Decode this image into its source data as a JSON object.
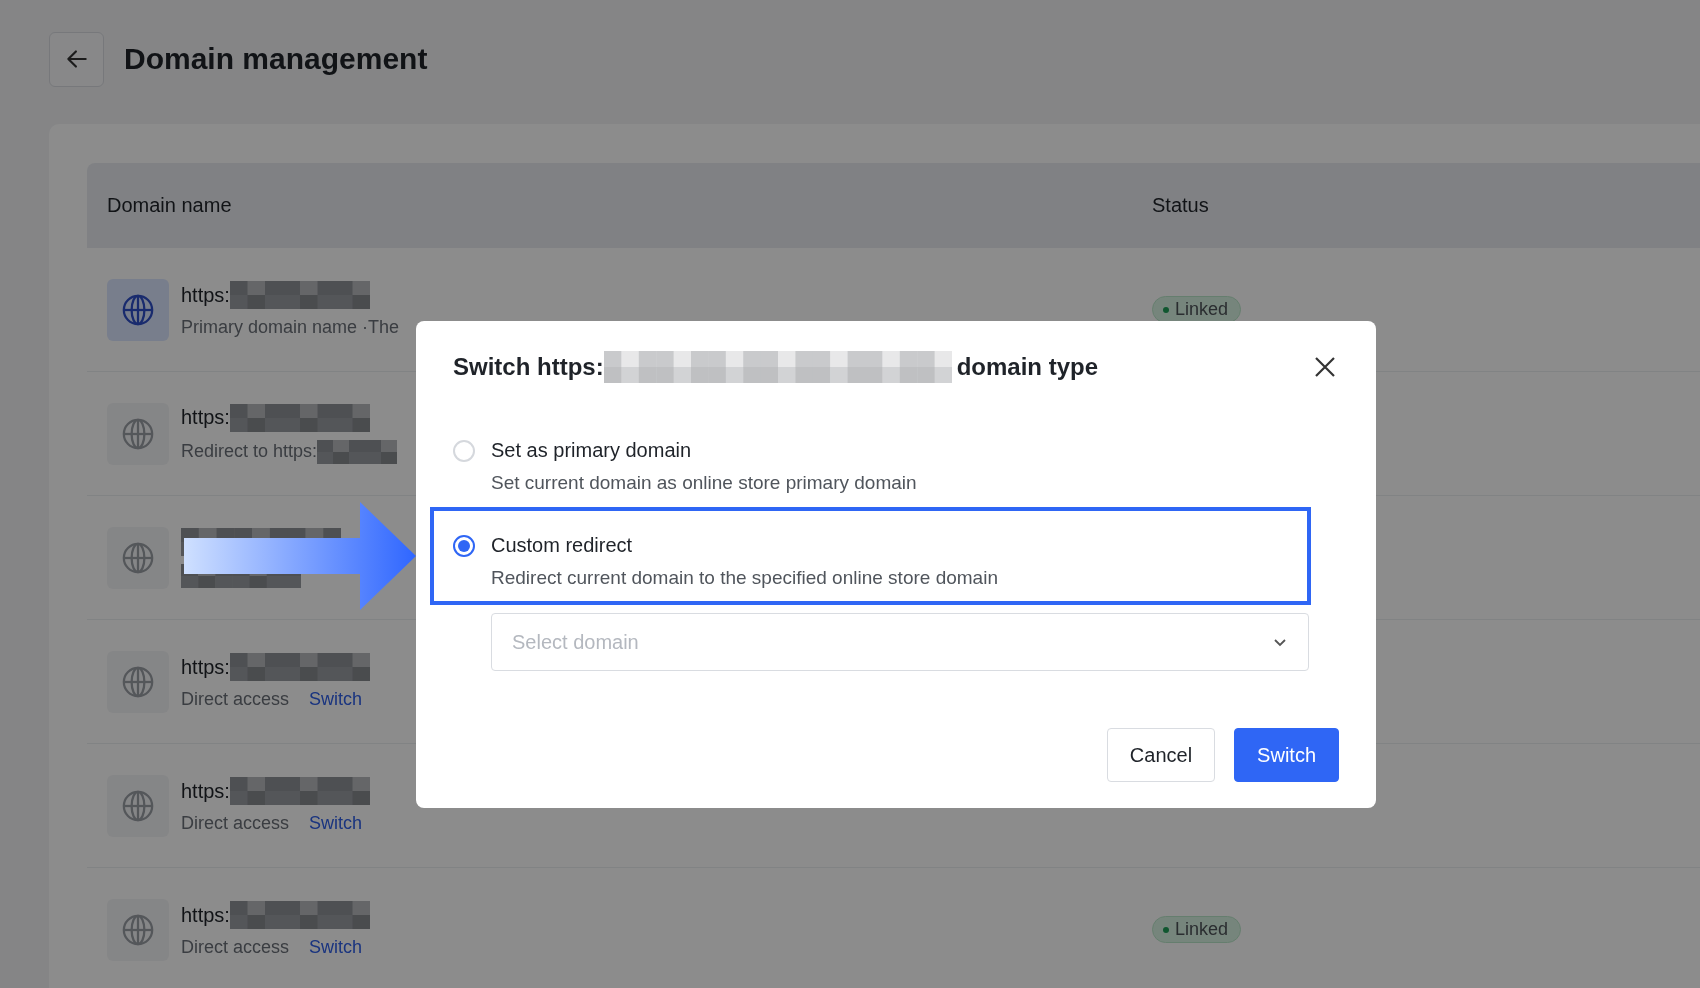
{
  "header": {
    "title": "Domain management"
  },
  "table": {
    "columns": [
      "Domain name",
      "Status"
    ],
    "rows": [
      {
        "primary": true,
        "title": "https:",
        "subtitle": "Primary domain name ·The",
        "subtitle_redacted": false,
        "status": "Linked"
      },
      {
        "primary": false,
        "title": "https:",
        "subtitle": "Redirect to https:",
        "subtitle_redacted": true
      },
      {
        "primary": false
      },
      {
        "primary": false,
        "title": "https:",
        "subtitle": "Direct access",
        "subtitle_redacted": false,
        "link": "Switch"
      },
      {
        "primary": false,
        "title": "https:",
        "subtitle": "Direct access",
        "subtitle_redacted": false,
        "link": "Switch"
      },
      {
        "primary": false,
        "title": "https:",
        "subtitle": "Direct access",
        "subtitle_redacted": false,
        "link": "Switch",
        "status": "Linked"
      }
    ]
  },
  "dialog": {
    "title_prefix": "Switch https:",
    "title_suffix": "domain type",
    "options": [
      {
        "label": "Set as primary domain",
        "description": "Set current domain as online store primary domain",
        "selected": false
      },
      {
        "label": "Custom redirect",
        "description": "Redirect current domain to the specified online store domain",
        "selected": true
      }
    ],
    "select": {
      "placeholder": "Select domain"
    },
    "buttons": [
      {
        "label": "Cancel",
        "kind": "secondary"
      },
      {
        "label": "Switch",
        "kind": "primary"
      }
    ]
  }
}
